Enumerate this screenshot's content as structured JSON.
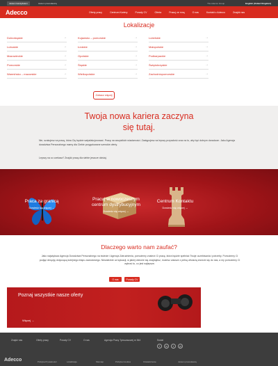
{
  "utilbar": {
    "item1": "Jestem kandydatem",
    "item2": "Jestem pracodawcą",
    "item3": "The Adecco Group",
    "item4": "English (United Kingdom)"
  },
  "header": {
    "logo": "Adecco",
    "nav": [
      "Oferty pracy",
      "Centrum Kariery",
      "Porady CV",
      "Oferta",
      "Pracuj ze mną",
      "O nas",
      "Kontakt z Adecco",
      "Znajdź nas"
    ]
  },
  "lokalizacje": {
    "title": "Lokalizacje",
    "items": [
      "Dolnośląskie",
      "Kujawsko – pomorskie",
      "Lubelskie",
      "Lubuskie",
      "Łódzkie",
      "Małopolskie",
      "Mazowieckie",
      "Opolskie",
      "Podkarpackie",
      "Pomorskie",
      "Śląskie",
      "Świętokrzyskie",
      "Warmińsko – mazurskie",
      "Wielkopolskie",
      "Zachodniopomorskie"
    ],
    "arrow": "→",
    "more_button": "Zobacz więcej"
  },
  "career": {
    "title_line1": "Twoja nowa kariera zaczyna",
    "title_line2": "się tutaj.",
    "paragraph1": "Nie, szukujesz na pracę, która Cię będzie satysfakcjonować. Pracę na wszystkich wiadomości. Zastępujesz na lepszy przyszłość oraz na to, aby być dobrym doradcom. Jako Agencja doradztwa Personalnego mamy dla Ciebie przygotowane szerokie oferty.",
    "paragraph2": "Lepszy na co czekasz? Znajdź pracę dla siebie jeszcze dzisiaj."
  },
  "tiles": [
    {
      "title": "Praca za granicą",
      "link": "Dowiedz się więcej →"
    },
    {
      "title_line1": "Pracuj w nowoczesnym",
      "title_line2": "centrum dystrybucyjnym",
      "link": "Dowiedz się więcej →"
    },
    {
      "title": "Centrum Kontaktu",
      "link": "Dowiedz się więcej →"
    }
  ],
  "why": {
    "title": "Dlaczego warto nam zaufać?",
    "paragraph": "Jako największa Agencja Doradztwa Personalnego na świecie i Agencja Zatrudnienia, pomożemy znaleźć Ci pracę, która będzie spełniać Twoje oczekiwania i potrzeby. Pomożemy Ci podjąć decyzję dotyczącą kolejnego etapu zawodowego. Niezależnie od sytuacji, w jakiej obecnie się znajdujesz, możesz zawsze z pełną ufnością zwrócić się do nas, a my pomożemy Ci wybrać to, co jest najlepsze.",
    "button1": "O nas",
    "button2": "Porady CV"
  },
  "offers": {
    "title": "Poznaj wszystkie nasze oferty",
    "link": "Więcej →"
  },
  "footer": {
    "links": [
      "Znajdź nas",
      "Oferty pracy",
      "Porady CV",
      "O nas",
      "Agencja Pracy Tymczasowej nr 364"
    ],
    "social_title": "Social",
    "social": [
      "f",
      "in",
      "t",
      "yt"
    ],
    "logo": "Adecco",
    "bottom": [
      "Polityka Prywatności",
      "Lokalizacje",
      "Sitemap",
      "Polityka Cookies",
      "Oświadczenie",
      "Jestem pracodawcą"
    ]
  }
}
